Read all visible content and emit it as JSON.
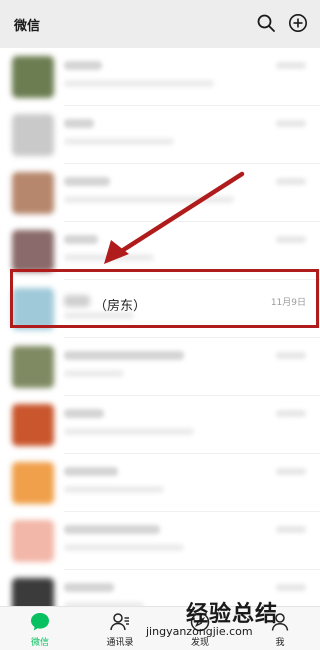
{
  "header": {
    "title": "微信",
    "search_icon": "search-icon",
    "add_icon": "plus-circle-icon"
  },
  "chats": [
    {
      "avatar_color": "#6d7d52",
      "blurred": true
    },
    {
      "avatar_color": "#c9c9c9",
      "blurred": true
    },
    {
      "avatar_color": "#b6876d",
      "blurred": true
    },
    {
      "avatar_color": "#8a6a6a",
      "blurred": true
    },
    {
      "avatar_color": "#9fc9d9",
      "blurred": false,
      "name": "（房东）",
      "time": "11月9日"
    },
    {
      "avatar_color": "#7f8a62",
      "blurred": true
    },
    {
      "avatar_color": "#c9562d",
      "blurred": true
    },
    {
      "avatar_color": "#f0a04b",
      "blurred": true
    },
    {
      "avatar_color": "#f2b7a8",
      "blurred": true
    },
    {
      "avatar_color": "#3b3b3b",
      "blurred": true
    }
  ],
  "tabs": [
    {
      "label": "微信",
      "icon": "chat-bubble-icon",
      "active": true
    },
    {
      "label": "通讯录",
      "icon": "contacts-icon",
      "active": false
    },
    {
      "label": "发现",
      "icon": "compass-icon",
      "active": false
    },
    {
      "label": "我",
      "icon": "person-icon",
      "active": false
    }
  ],
  "watermark": {
    "main": "经验总结",
    "sub": "jingyanzongjie.com"
  },
  "colors": {
    "accent": "#07c160",
    "annotation": "#b01c1c"
  }
}
